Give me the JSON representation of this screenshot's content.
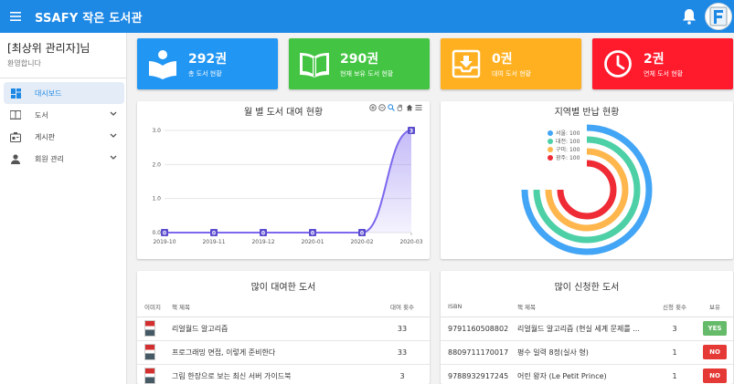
{
  "header": {
    "title": "SSAFY 작은 도서관",
    "menu_icon": "menu-icon",
    "bell_icon": "bell-icon"
  },
  "sidebar": {
    "user_name": "[최상위 관리자]님",
    "welcome": "환영합니다",
    "items": [
      {
        "label": "대시보드",
        "icon": "dashboard-icon",
        "active": true
      },
      {
        "label": "도서",
        "icon": "book-icon",
        "expandable": true
      },
      {
        "label": "게시판",
        "icon": "board-icon",
        "expandable": true
      },
      {
        "label": "회원 관리",
        "icon": "person-icon",
        "expandable": true
      }
    ]
  },
  "stats": [
    {
      "count": "292권",
      "label": "총 도서 현황",
      "color": "#2196f3"
    },
    {
      "count": "290권",
      "label": "현재 보유 도서 현황",
      "color": "#43c543"
    },
    {
      "count": "0권",
      "label": "대여 도서 현황",
      "color": "#ffb020"
    },
    {
      "count": "2권",
      "label": "연체 도서 현황",
      "color": "#ff1a2c"
    }
  ],
  "monthly_chart": {
    "title": "월 별 도서 대여 현황",
    "chart_data": {
      "type": "area",
      "categories": [
        "2019-10",
        "2019-11",
        "2019-12",
        "2020-01",
        "2020-02",
        "2020-03"
      ],
      "values": [
        0,
        0,
        0,
        0,
        0,
        3
      ],
      "y_ticks": [
        "0.0",
        "1.0",
        "2.0",
        "3.0"
      ],
      "ylim": [
        0,
        3
      ],
      "grid": true,
      "color": "#7b68ee"
    }
  },
  "region_chart": {
    "title": "지역별 반납 현황",
    "chart_data": {
      "type": "radialBar",
      "series": [
        {
          "name": "서울",
          "value": 100,
          "color": "#42a5f5"
        },
        {
          "name": "대전",
          "value": 100,
          "color": "#4dd0a6"
        },
        {
          "name": "구미",
          "value": 100,
          "color": "#ffb74d"
        },
        {
          "name": "광주",
          "value": 100,
          "color": "#ef2b35"
        }
      ],
      "legend_items": [
        "서울: 100",
        "대전: 100",
        "구미: 100",
        "광주: 100"
      ]
    }
  },
  "popular_rented": {
    "title": "많이 대여한 도서",
    "columns": [
      "이미지",
      "책 제목",
      "대여 횟수"
    ],
    "rows": [
      {
        "title": "리얼월드 알고리즘",
        "count": "33"
      },
      {
        "title": "프로그래밍 면접, 이렇게 준비한다",
        "count": "33"
      },
      {
        "title": "그림 한장으로 보는 최신 서버 가이드북",
        "count": "3"
      }
    ]
  },
  "popular_requested": {
    "title": "많이 신청한 도서",
    "columns": [
      "ISBN",
      "책 제목",
      "신청 횟수",
      "보유"
    ],
    "rows": [
      {
        "isbn": "9791160508802",
        "title": "리얼월드 알고리즘 (현실 세계 문제를 ...",
        "count": "3",
        "owned": "YES"
      },
      {
        "isbn": "8809711170017",
        "title": "평수 일력 8정(실사 형)",
        "count": "1",
        "owned": "NO"
      },
      {
        "isbn": "9788932917245",
        "title": "어린 왕자 (Le Petit Prince)",
        "count": "1",
        "owned": "NO"
      }
    ]
  }
}
